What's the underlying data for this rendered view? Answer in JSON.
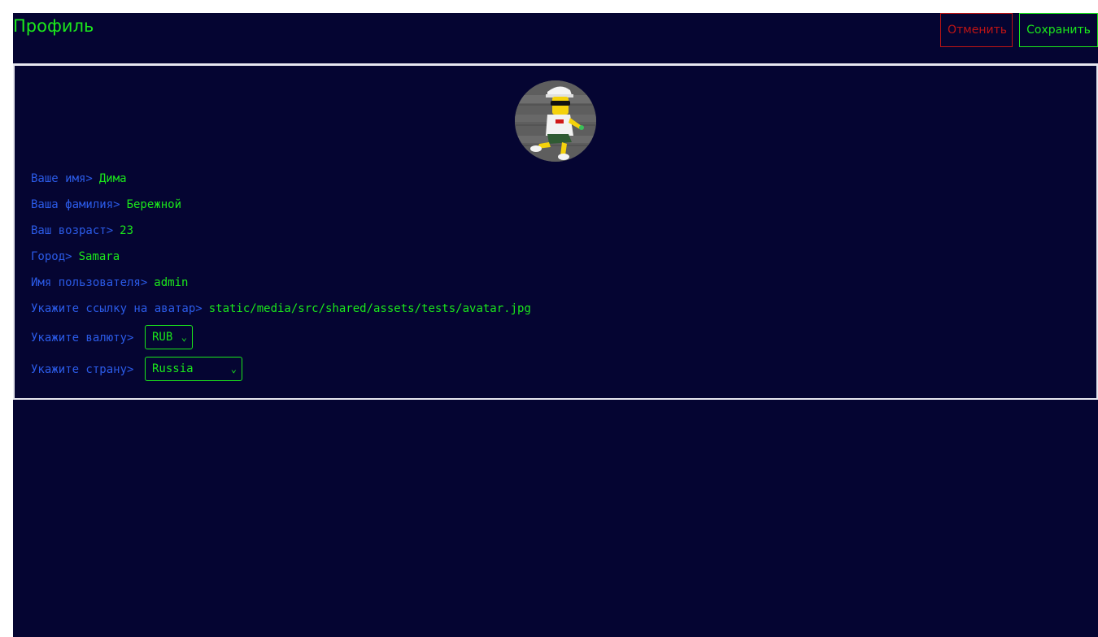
{
  "header": {
    "title": "Профиль",
    "cancel_label": "Отменить",
    "save_label": "Сохранить"
  },
  "profile": {
    "avatar_icon": "bart-simpson-avatar",
    "fields": {
      "first_name": {
        "label": "Ваше имя>",
        "value": "Дима"
      },
      "last_name": {
        "label": "Ваша фамилия>",
        "value": "Бережной"
      },
      "age": {
        "label": "Ваш возраст>",
        "value": "23"
      },
      "city": {
        "label": "Город>",
        "value": "Samara"
      },
      "username": {
        "label": "Имя пользователя>",
        "value": "admin"
      },
      "avatar_url": {
        "label": "Укажите ссылку на аватар>",
        "value": "static/media/src/shared/assets/tests/avatar.jpg"
      },
      "currency": {
        "label": "Укажите валюту>",
        "value": "RUB"
      },
      "country": {
        "label": "Укажите страну>",
        "value": "Russia"
      }
    }
  },
  "colors": {
    "background": "#050532",
    "label": "#2b5be8",
    "value": "#1be81b",
    "cancel": "#c01414",
    "divider": "#e8e8f0"
  }
}
